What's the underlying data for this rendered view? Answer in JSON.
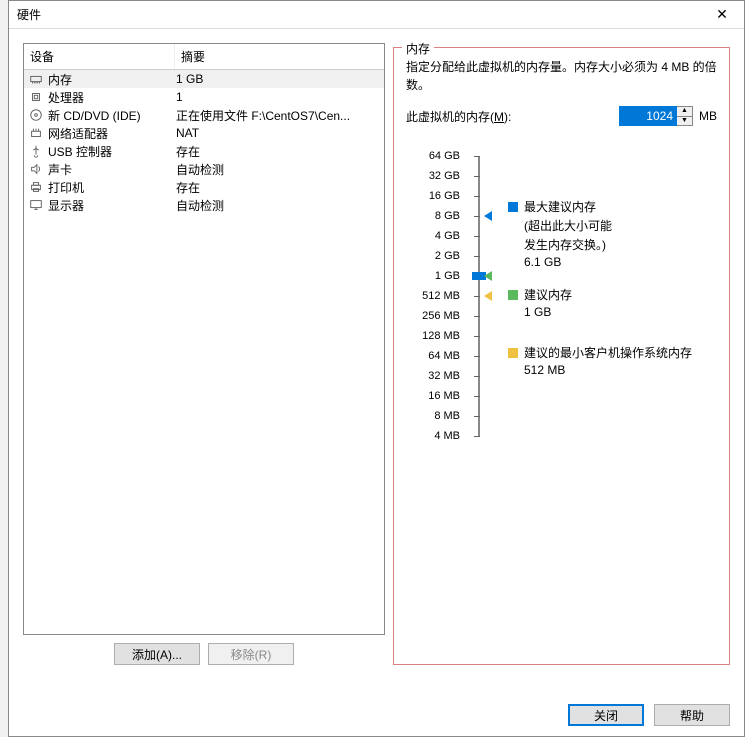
{
  "title": "硬件",
  "columns": {
    "device": "设备",
    "summary": "摘要"
  },
  "devices": [
    {
      "icon": "memory",
      "name": "内存",
      "summary": "1 GB",
      "selected": true
    },
    {
      "icon": "cpu",
      "name": "处理器",
      "summary": "1"
    },
    {
      "icon": "cd",
      "name": "新 CD/DVD (IDE)",
      "summary": "正在使用文件 F:\\CentOS7\\Cen..."
    },
    {
      "icon": "net",
      "name": "网络适配器",
      "summary": "NAT"
    },
    {
      "icon": "usb",
      "name": "USB 控制器",
      "summary": "存在"
    },
    {
      "icon": "sound",
      "name": "声卡",
      "summary": "自动检测"
    },
    {
      "icon": "printer",
      "name": "打印机",
      "summary": "存在"
    },
    {
      "icon": "display",
      "name": "显示器",
      "summary": "自动检测"
    }
  ],
  "buttons": {
    "add": "添加(A)...",
    "remove": "移除(R)",
    "close": "关闭",
    "help": "帮助"
  },
  "memory": {
    "section_title": "内存",
    "desc": "指定分配给此虚拟机的内存量。内存大小必须为 4 MB 的倍数。",
    "input_label_pre": "此虚拟机的内存(",
    "input_label_key": "M",
    "input_label_post": "):",
    "value": "1024",
    "unit": "MB",
    "ticks": [
      "64 GB",
      "32 GB",
      "16 GB",
      "8 GB",
      "4 GB",
      "2 GB",
      "1 GB",
      "512 MB",
      "256 MB",
      "128 MB",
      "64 MB",
      "32 MB",
      "16 MB",
      "8 MB",
      "4 MB"
    ],
    "legend": {
      "max": {
        "title": "最大建议内存",
        "sub1": "(超出此大小可能",
        "sub2": "发生内存交换。)",
        "value": "6.1 GB"
      },
      "rec": {
        "title": "建议内存",
        "value": "1 GB"
      },
      "min": {
        "title": "建议的最小客户机操作系统内存",
        "value": "512 MB"
      }
    }
  }
}
